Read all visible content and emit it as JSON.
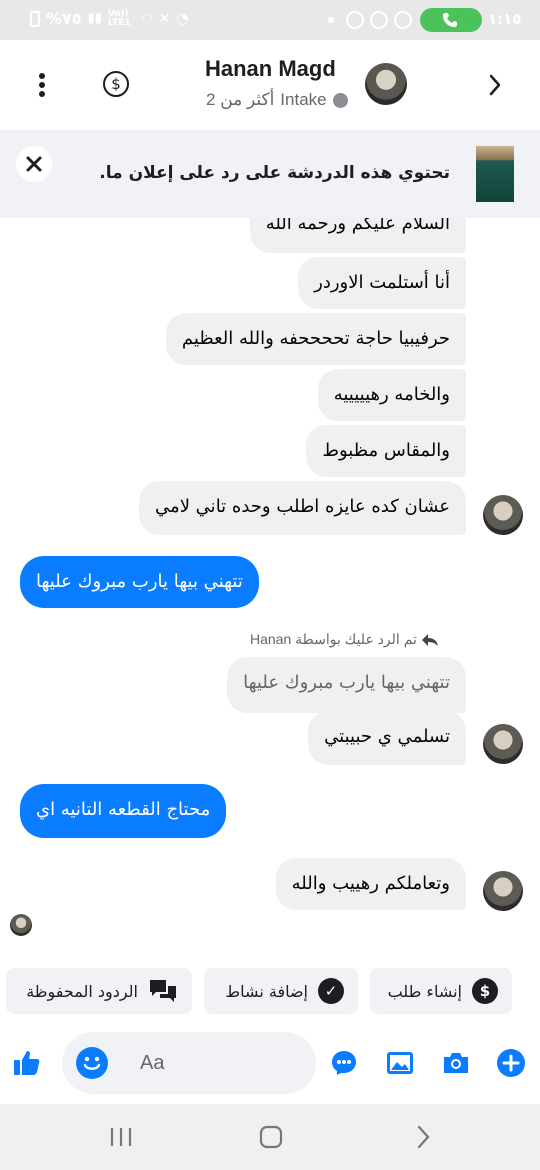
{
  "status_bar": {
    "battery": "%٧٥",
    "network": "Vo)) LTE1",
    "clock": "١:١٥",
    "accent": "#4cc35a"
  },
  "header": {
    "name": "Hanan Magd",
    "label": "Intake",
    "more_count": "أكثر من 2",
    "icons": [
      "back-arrow-icon",
      "more-vertical-icon",
      "dollar-circle-icon"
    ]
  },
  "ad_banner": {
    "text": "تحتوي هذه الدردشة على رد على إعلان ما."
  },
  "messages": [
    {
      "dir": "in",
      "text": "السلام عليكم ورحمه الله"
    },
    {
      "dir": "in",
      "text": "أنا أستلمت الاوردر"
    },
    {
      "dir": "in",
      "text": "حرفيبيا حاجة تححححفه والله العظيم"
    },
    {
      "dir": "in",
      "text": "والخامه رهيييييه"
    },
    {
      "dir": "in",
      "text": "والمقاس  مظبوط"
    },
    {
      "dir": "in",
      "text": "عشان كده عايزه اطلب وحده تاني لامي"
    },
    {
      "dir": "out",
      "text": "تتهني بيها يارب مبروك عليها"
    },
    {
      "dir": "in",
      "reply_note": "تم الرد عليك بواسطة Hanan",
      "quoted": "تتهني بيها يارب مبروك عليها",
      "text": "تسلمي ي حبيبتي"
    },
    {
      "dir": "out",
      "text": "محتاج القطعه التانيه اي"
    },
    {
      "dir": "in",
      "text": "وتعاملكم رهييب والله"
    }
  ],
  "quick_actions": [
    {
      "label": "إنشاء طلب",
      "icon": "dollar-circle-icon"
    },
    {
      "label": "إضافة نشاط",
      "icon": "check-circle-icon"
    },
    {
      "label": "الردود المحفوظة",
      "icon": "chat-bubbles-icon"
    }
  ],
  "composer": {
    "placeholder": "Aa",
    "icons": [
      "add-icon",
      "camera-icon",
      "gallery-icon",
      "messenger-icon",
      "emoji-icon",
      "thumbs-up-icon"
    ],
    "brand_color": "#0a7cff"
  },
  "navbar": {
    "icons": [
      "recent-apps-icon",
      "home-icon",
      "back-icon"
    ]
  }
}
